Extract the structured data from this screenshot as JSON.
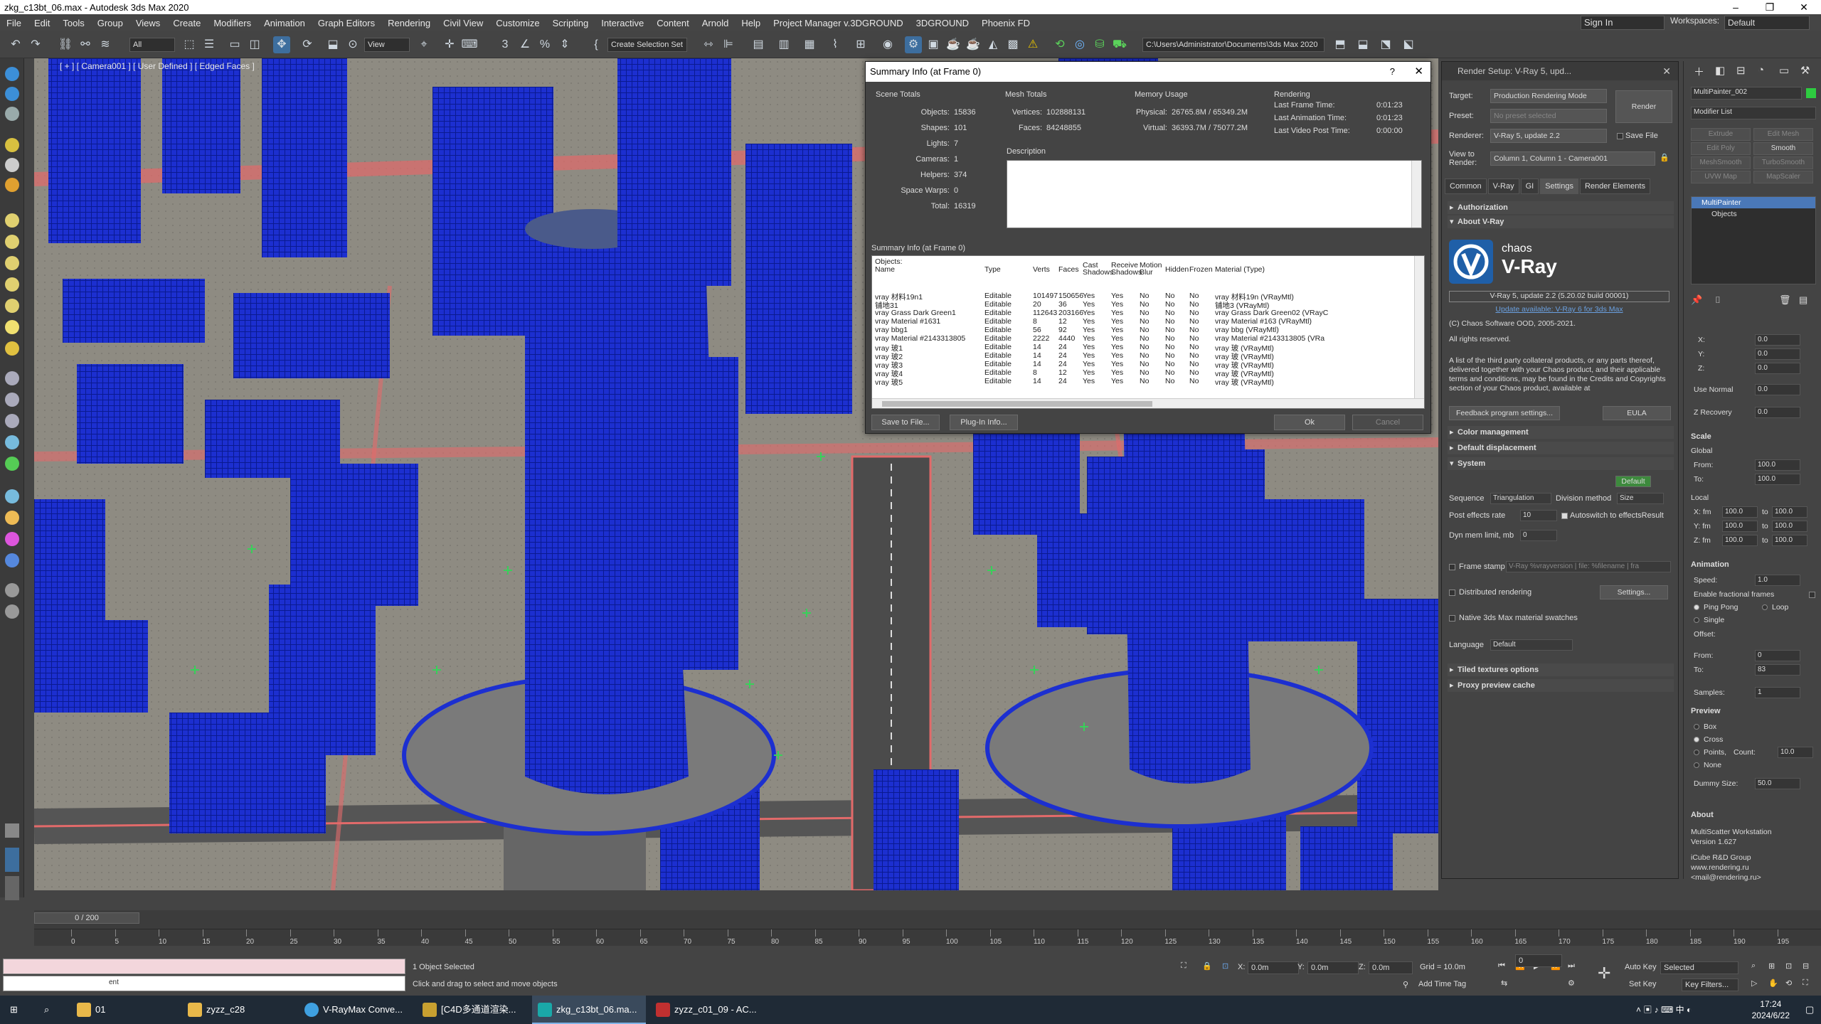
{
  "window": {
    "title": "zkg_c13bt_06.max - Autodesk 3ds Max 2020",
    "minimize": "–",
    "restore": "❐",
    "close": "✕"
  },
  "menu": {
    "items": [
      "File",
      "Edit",
      "Tools",
      "Group",
      "Views",
      "Create",
      "Modifiers",
      "Animation",
      "Graph Editors",
      "Rendering",
      "Civil View",
      "Customize",
      "Scripting",
      "Interactive",
      "Content",
      "Arnold",
      "Help",
      "Project Manager v.3DGROUND",
      "3DGROUND",
      "Phoenix FD"
    ],
    "sign_in": "Sign In",
    "workspaces_label": "Workspaces:",
    "workspaces_value": "Default"
  },
  "toolbar": {
    "filter": "All",
    "ref_coord": "View",
    "selection_set": "Create Selection Set",
    "project_path": "C:\\Users\\Administrator\\Documents\\3ds Max 2020"
  },
  "viewport": {
    "label": "[ + ] [ Camera001 ] [ User Defined ] [ Edged Faces ]"
  },
  "summary": {
    "title": "Summary Info (at Frame 0)",
    "help": "?",
    "close": "✕",
    "scene_totals": {
      "header": "Scene Totals",
      "rows": [
        {
          "k": "Objects:",
          "v": "15836"
        },
        {
          "k": "Shapes:",
          "v": "101"
        },
        {
          "k": "Lights:",
          "v": "7"
        },
        {
          "k": "Cameras:",
          "v": "1"
        },
        {
          "k": "Helpers:",
          "v": "374"
        },
        {
          "k": "Space Warps:",
          "v": "0"
        },
        {
          "k": "Total:",
          "v": "16319"
        }
      ]
    },
    "mesh_totals": {
      "header": "Mesh Totals",
      "rows": [
        {
          "k": "Vertices:",
          "v": "102888131"
        },
        {
          "k": "Faces:",
          "v": "84248855"
        }
      ]
    },
    "memory": {
      "header": "Memory Usage",
      "rows": [
        {
          "k": "Physical:",
          "v": "26765.8M / 65349.2M"
        },
        {
          "k": "Virtual:",
          "v": "36393.7M / 75077.2M"
        }
      ]
    },
    "rendering": {
      "header": "Rendering",
      "rows": [
        {
          "k": "Last Frame Time:",
          "v": "0:01:23"
        },
        {
          "k": "Last Animation Time:",
          "v": "0:01:23"
        },
        {
          "k": "Last Video Post Time:",
          "v": "0:00:00"
        }
      ]
    },
    "description_label": "Description",
    "info_label": "Summary Info (at Frame 0)",
    "objects_label": "Objects:",
    "columns": [
      "Name",
      "Type",
      "Verts",
      "Faces",
      "Cast Shadows",
      "Receive Shadows",
      "Motion Blur",
      "Hidden",
      "Frozen",
      "Material (Type)"
    ],
    "rows": [
      [
        "vray 材料19n1",
        "Editable",
        "101497",
        "150656",
        "Yes",
        "Yes",
        "No",
        "No",
        "No",
        "vray 材料19n (VRayMtl)"
      ],
      [
        "铺地31",
        "Editable",
        "20",
        "36",
        "Yes",
        "Yes",
        "No",
        "No",
        "No",
        "铺地3 (VRayMtl)"
      ],
      [
        "vray Grass Dark Green1",
        "Editable",
        "112643",
        "203166",
        "Yes",
        "Yes",
        "No",
        "No",
        "No",
        "vray Grass Dark Green02 (VRayC"
      ],
      [
        "vray Material #1631",
        "Editable",
        "8",
        "12",
        "Yes",
        "Yes",
        "No",
        "No",
        "No",
        "vray Material #163 (VRayMtl)"
      ],
      [
        "vray bbg1",
        "Editable",
        "56",
        "92",
        "Yes",
        "Yes",
        "No",
        "No",
        "No",
        "vray bbg (VRayMtl)"
      ],
      [
        "vray Material #2143313805",
        "Editable",
        "2222",
        "4440",
        "Yes",
        "Yes",
        "No",
        "No",
        "No",
        "vray Material #2143313805 (VRa"
      ],
      [
        "vray 玻1",
        "Editable",
        "14",
        "24",
        "Yes",
        "Yes",
        "No",
        "No",
        "No",
        "vray 玻 (VRayMtl)"
      ],
      [
        "vray 玻2",
        "Editable",
        "14",
        "24",
        "Yes",
        "Yes",
        "No",
        "No",
        "No",
        "vray 玻 (VRayMtl)"
      ],
      [
        "vray 玻3",
        "Editable",
        "14",
        "24",
        "Yes",
        "Yes",
        "No",
        "No",
        "No",
        "vray 玻 (VRayMtl)"
      ],
      [
        "vray 玻4",
        "Editable",
        "8",
        "12",
        "Yes",
        "Yes",
        "No",
        "No",
        "No",
        "vray 玻 (VRayMtl)"
      ],
      [
        "vray 玻5",
        "Editable",
        "14",
        "24",
        "Yes",
        "Yes",
        "No",
        "No",
        "No",
        "vray 玻 (VRayMtl)"
      ]
    ],
    "buttons": {
      "save": "Save to File...",
      "plugin": "Plug-In Info...",
      "ok": "Ok",
      "cancel": "Cancel"
    }
  },
  "render_setup": {
    "title": "Render Setup: V-Ray 5, upd...",
    "target_label": "Target:",
    "target_value": "Production Rendering Mode",
    "preset_label": "Preset:",
    "preset_value": "No preset selected",
    "renderer_label": "Renderer:",
    "renderer_value": "V-Ray 5, update 2.2",
    "save_file": "Save File",
    "view_label": "View to Render:",
    "view_value": "Column 1, Column 1 - Camera001",
    "render_button": "Render",
    "tabs": [
      "Common",
      "V-Ray",
      "GI",
      "Settings",
      "Render Elements"
    ],
    "rollouts": {
      "authorization": "Authorization",
      "about": "About V-Ray",
      "color": "Color management",
      "displacement": "Default displacement",
      "system": "System",
      "tiled": "Tiled textures options",
      "proxy": "Proxy preview cache"
    },
    "logo_top": "chaos",
    "logo_bottom": "V-Ray",
    "version": "V-Ray 5, update 2.2 (5.20.02 build 00001)",
    "update": "Update available: V-Ray 6 for 3ds Max",
    "copyright": "(C) Chaos Software OOD, 2005-2021.",
    "rights": "All rights reserved.",
    "para": "A list of the third party collateral products, or any parts thereof, delivered together with your Chaos product, and their applicable terms and conditions, may be found in the Credits and Copyrights section of your Chaos product, available at",
    "feedback": "Feedback program settings...",
    "eula": "EULA",
    "default_btn": "Default",
    "sequence_label": "Sequence",
    "sequence_value": "Triangulation",
    "division_label": "Division method",
    "division_value": "Size",
    "post_label": "Post effects rate",
    "post_value": "10",
    "autoswitch": "Autoswitch to effectsResult",
    "dyn_label": "Dyn mem limit, mb",
    "dyn_value": "0",
    "stamp_label": "Frame stamp",
    "stamp_value": "V-Ray %vrayversion | file: %filename | fra",
    "distributed": "Distributed rendering",
    "settings_btn": "Settings...",
    "native": "Native 3ds Max material swatches",
    "language_label": "Language",
    "language_value": "Default"
  },
  "command_panel": {
    "object_name": "MultiPainter_002",
    "modifier_list": "Modifier List",
    "mod_buttons": [
      "Extrude",
      "Edit Mesh",
      "Edit Poly",
      "Smooth",
      "MeshSmooth",
      "TurboSmooth",
      "UVW Map",
      "MapScaler"
    ],
    "stack_items": [
      "MultiPainter",
      "Objects"
    ],
    "xyz": [
      {
        "k": "X:",
        "v": "0.0"
      },
      {
        "k": "Y:",
        "v": "0.0"
      },
      {
        "k": "Z:",
        "v": "0.0"
      }
    ],
    "use_normal": "Use Normal",
    "use_normal_v": "0.0",
    "z_recovery": "Z Recovery",
    "z_recovery_v": "0.0",
    "scale_hdr": "Scale",
    "global": "Global",
    "from_label": "From:",
    "from_v": "100.0",
    "to_label": "To:",
    "to_v": "100.0",
    "local": "Local",
    "local_rows": [
      {
        "k": "X: fm",
        "a": "100.0",
        "t": "to",
        "b": "100.0"
      },
      {
        "k": "Y: fm",
        "a": "100.0",
        "t": "to",
        "b": "100.0"
      },
      {
        "k": "Z: fm",
        "a": "100.0",
        "t": "to",
        "b": "100.0"
      }
    ],
    "anim_hdr": "Animation",
    "speed_label": "Speed:",
    "speed_v": "1.0",
    "fractional": "Enable fractional frames",
    "pingpong": "Ping Pong",
    "loop": "Loop",
    "single": "Single",
    "offset": "Offset:",
    "off_from": "From:",
    "off_from_v": "0",
    "off_to": "To:",
    "off_to_v": "83",
    "samples": "Samples:",
    "samples_v": "1",
    "preview_hdr": "Preview",
    "box": "Box",
    "cross": "Cross",
    "points": "Points,",
    "count": "Count:",
    "count_v": "10.0",
    "none": "None",
    "dummy": "Dummy Size:",
    "dummy_v": "50.0",
    "about_hdr": "About",
    "about_lines": [
      "MultiScatter Workstation",
      "Version 1.627",
      "",
      "iCube R&D Group",
      "www.rendering.ru",
      "<mail@rendering.ru>"
    ]
  },
  "timeline": {
    "slider": "0 / 200",
    "ticks": [
      "0",
      "5",
      "10",
      "15",
      "20",
      "25",
      "30",
      "35",
      "40",
      "45",
      "50",
      "55",
      "60",
      "65",
      "70",
      "75",
      "80",
      "85",
      "90",
      "95",
      "100",
      "105",
      "110",
      "115",
      "120",
      "125",
      "130",
      "135",
      "140",
      "145",
      "150",
      "155",
      "160",
      "165",
      "170",
      "175",
      "180",
      "185",
      "190",
      "195"
    ]
  },
  "status": {
    "selected": "1 Object Selected",
    "hint": "Click and drag to select and move objects",
    "x_label": "X:",
    "x": "0.0m",
    "y_label": "Y:",
    "y": "0.0m",
    "z_label": "Z:",
    "z": "0.0m",
    "grid": "Grid = 10.0m",
    "add_time_tag": "Add Time Tag",
    "frame": "0",
    "auto_key": "Auto Key",
    "selected_dd": "Selected",
    "set_key": "Set Key",
    "key_filters": "Key Filters...",
    "mini_text": "ent"
  },
  "taskbar": {
    "items": [
      "01",
      "zyzz_c28",
      "V-RayMax Conve...",
      "[C4D多通道渲染...",
      "zkg_c13bt_06.ma...",
      "zyzz_c01_09 - AC..."
    ],
    "time": "17:24",
    "date": "2024/6/22"
  }
}
